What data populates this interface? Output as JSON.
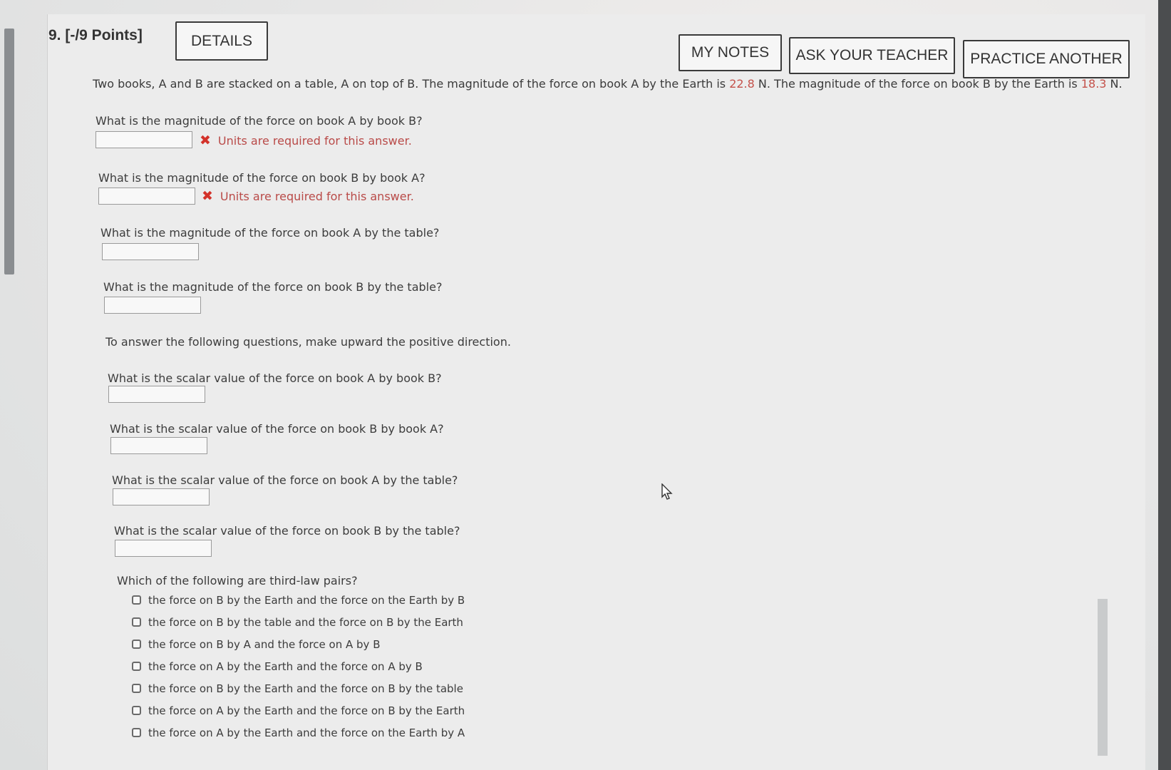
{
  "header": {
    "question_label": "9.  [-/9 Points]",
    "details_button": "DETAILS",
    "my_notes_button": "MY NOTES",
    "ask_teacher_button": "ASK YOUR TEACHER",
    "practice_button": "PRACTICE ANOTHER"
  },
  "problem": {
    "text_1": "Two books, A and B are stacked on a table, A on top of B. The magnitude of the force on book A by the Earth is ",
    "value_a": "22.8",
    "text_2": " N. The magnitude of the force on book B by the Earth is ",
    "value_b": "18.3",
    "text_3": " N."
  },
  "error_message": "Units are required for this answer.",
  "questions": [
    "What is the magnitude of the force on book A by book B?",
    "What is the magnitude of the force on book B by book A?",
    "What is the magnitude of the force on book A by the table?",
    "What is the magnitude of the force on book B by the table?",
    "What is the scalar value of the force on book A by book B?",
    "What is the scalar value of the force on book B by book A?",
    "What is the scalar value of the force on book A by the table?",
    "What is the scalar value of the force on book B by the table?"
  ],
  "direction_note": "To answer the following questions, make upward the positive direction.",
  "third_law": {
    "prompt": "Which of the following are third-law pairs?",
    "options": [
      "the force on B by the Earth and the force on the Earth by B",
      "the force on B by the table and the force on B by the Earth",
      "the force on B by A and the force on A by B",
      "the force on A by the Earth and the force on A by B",
      "the force on B by the Earth and the force on B by the table",
      "the force on A by the Earth and the force on B by the Earth",
      "the force on A by the Earth and the force on the Earth by A"
    ]
  },
  "colors": {
    "highlight": "#c4514a",
    "error": "#b94a48"
  }
}
